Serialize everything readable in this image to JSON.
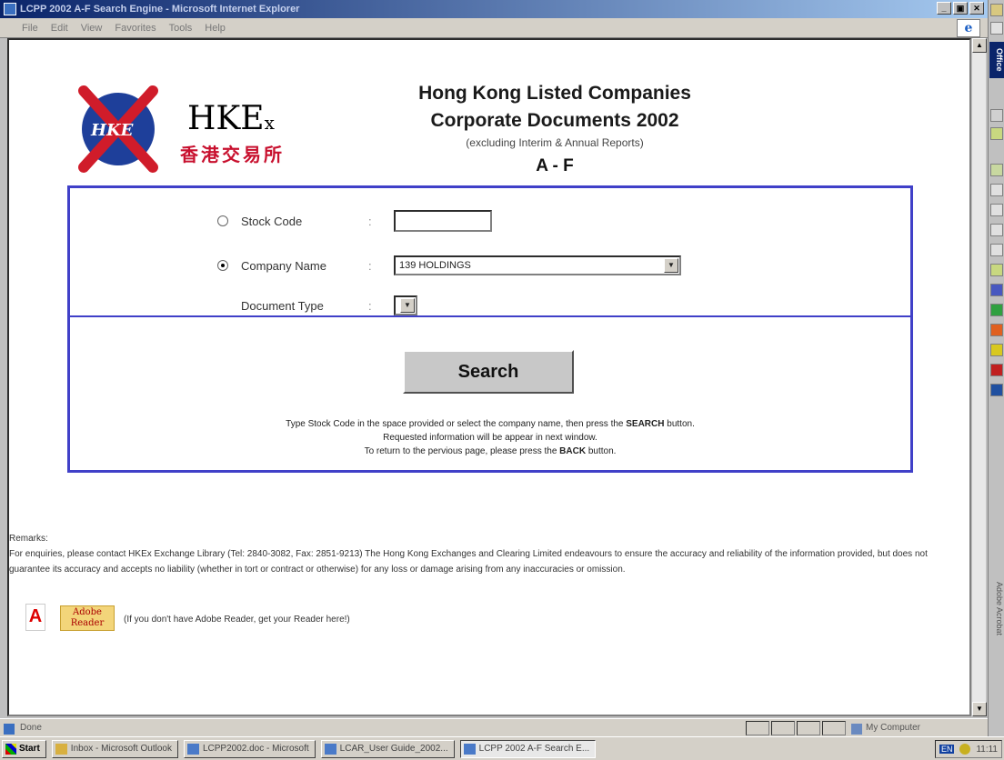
{
  "window": {
    "title": "LCPP 2002 A-F Search Engine - Microsoft Internet Explorer",
    "controls": [
      "_",
      "▣",
      "✕"
    ]
  },
  "menu": [
    "File",
    "Edit",
    "View",
    "Favorites",
    "Tools",
    "Help"
  ],
  "logo": {
    "mark": "HKE",
    "name_main": "HKE",
    "name_suffix": "x",
    "chinese": "香港交易所"
  },
  "header": {
    "line1": "Hong Kong Listed Companies",
    "line2": "Corporate Documents 2002",
    "line3": "(excluding Interim & Annual Reports)",
    "range": "A - F"
  },
  "form": {
    "stock_code": {
      "label": "Stock Code",
      "colon": ":",
      "value": "",
      "selected": false
    },
    "company_name": {
      "label": "Company Name",
      "colon": ":",
      "value": "139 HOLDINGS",
      "selected": true
    },
    "document_type": {
      "label": "Document Type",
      "colon": ":",
      "value": ""
    },
    "search_label": "Search",
    "instructions": [
      {
        "pre": "Type Stock Code in the space provided or select the company name, then press the ",
        "bold": "SEARCH",
        "post": " button."
      },
      {
        "pre": "Requested information will be appear in next window.",
        "bold": "",
        "post": ""
      },
      {
        "pre": "To return to the pervious page, please press the ",
        "bold": "BACK",
        "post": " button."
      }
    ]
  },
  "remarks": {
    "heading": "Remarks:",
    "body": "For enquiries, please contact HKEx Exchange Library (Tel: 2840-3082, Fax: 2851-9213) The Hong Kong Exchanges and Clearing Limited endeavours to ensure the accuracy and reliability of the information provided, but does not guarantee its accuracy and accepts no liability (whether in tort or contract or otherwise) for any loss or damage arising from any inaccuracies or omission.",
    "adobe_text": "(If you don't have Adobe Reader, get your Reader here!)",
    "adobe_logo_line1": "Adobe",
    "adobe_logo_line2": "Reader"
  },
  "statusbar": {
    "status": "Done",
    "zone": "My Computer"
  },
  "taskbar": {
    "start": "Start",
    "tasks": [
      "Inbox - Microsoft Outlook",
      "LCPP2002.doc - Microsoft",
      "LCAR_User Guide_2002...",
      "LCPP 2002 A-F Search E..."
    ],
    "lang": "EN",
    "clock": "11:11"
  },
  "office_bar": {
    "label": "Office",
    "bottom_label": "Adobe Acrobat"
  }
}
